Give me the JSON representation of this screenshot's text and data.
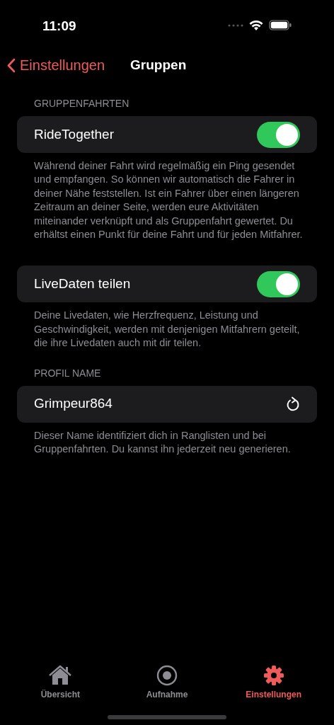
{
  "status_bar": {
    "time": "11:09"
  },
  "nav": {
    "back": "Einstellungen",
    "title": "Gruppen"
  },
  "sections": [
    {
      "header": "GRUPPENFAHRTEN",
      "rows": [
        {
          "kind": "toggle",
          "label": "RideTogether",
          "on": true
        }
      ],
      "footer": "Während deiner Fahrt wird regelmäßig ein Ping gesendet und empfangen. So können wir automatisch die Fahrer in deiner Nähe feststellen. Ist ein Fahrer über einen längeren Zeitraum an deiner Seite, werden eure Aktivitäten miteinander verknüpft und als Gruppenfahrt gewertet. Du erhältst einen Punkt für deine Fahrt und für jeden Mitfahrer."
    },
    {
      "rows": [
        {
          "kind": "toggle",
          "label": "LiveDaten teilen",
          "on": true
        }
      ],
      "footer": "Deine Livedaten, wie Herzfrequenz, Leistung und Geschwindigkeit, werden mit denjenigen Mitfahrern geteilt, die ihre Livedaten auch mit dir teilen."
    },
    {
      "header": "PROFIL NAME",
      "rows": [
        {
          "kind": "regenerate",
          "label": "Grimpeur864"
        }
      ],
      "footer": "Dieser Name identifiziert dich in Ranglisten und bei Gruppenfahrten. Du kannst ihn jederzeit neu generieren."
    }
  ],
  "tabs": [
    {
      "label": "Übersicht",
      "selected": false
    },
    {
      "label": "Aufnahme",
      "selected": false
    },
    {
      "label": "Einstellungen",
      "selected": true
    }
  ]
}
